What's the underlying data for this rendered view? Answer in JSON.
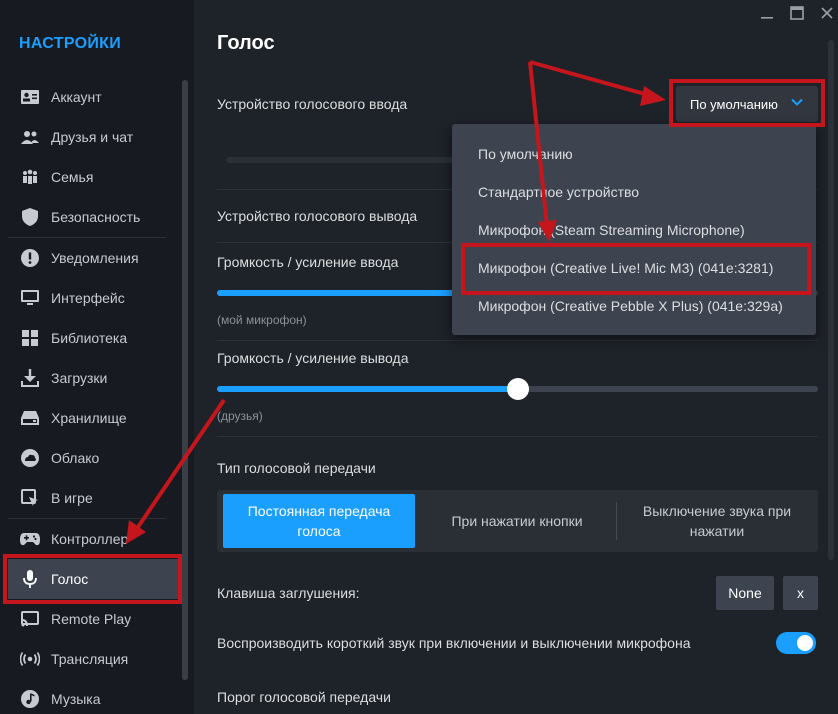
{
  "window": {
    "minimize_icon": "minimize-icon",
    "maximize_icon": "maximize-icon",
    "close_icon": "close-icon"
  },
  "sidebar": {
    "title": "НАСТРОЙКИ",
    "items": [
      {
        "label": "Аккаунт",
        "icon": "id-card-icon"
      },
      {
        "label": "Друзья и чат",
        "icon": "friends-icon"
      },
      {
        "label": "Семья",
        "icon": "family-icon"
      },
      {
        "label": "Безопасность",
        "icon": "shield-icon"
      },
      {
        "label": "Уведомления",
        "icon": "alert-icon"
      },
      {
        "label": "Интерфейс",
        "icon": "monitor-icon"
      },
      {
        "label": "Библиотека",
        "icon": "grid-icon"
      },
      {
        "label": "Загрузки",
        "icon": "download-icon"
      },
      {
        "label": "Хранилище",
        "icon": "drive-icon"
      },
      {
        "label": "Облако",
        "icon": "cloud-icon"
      },
      {
        "label": "В игре",
        "icon": "ingame-icon"
      },
      {
        "label": "Контроллер",
        "icon": "gamepad-icon"
      },
      {
        "label": "Голос",
        "icon": "microphone-icon"
      },
      {
        "label": "Remote Play",
        "icon": "cast-icon"
      },
      {
        "label": "Трансляция",
        "icon": "broadcast-icon"
      },
      {
        "label": "Музыка",
        "icon": "music-icon"
      }
    ]
  },
  "main": {
    "title": "Голос",
    "input_device_label": "Устройство голосового ввода",
    "input_device_value": "По умолчанию",
    "output_device_label": "Устройство голосового вывода",
    "input_volume_label": "Громкость / усиление ввода",
    "input_volume_hint": "(мой микрофон)",
    "output_volume_label": "Громкость / усиление вывода",
    "output_volume_hint": "(друзья)",
    "output_volume_level": 0.5,
    "transmission_label": "Тип голосовой передачи",
    "transmission_options": [
      "Постоянная передача голоса",
      "При нажатии кнопки",
      "Выключение звука при нажатии"
    ],
    "mute_key_label": "Клавиша заглушения:",
    "mute_key_value": "None",
    "mute_key_clear": "x",
    "play_sound_label": "Воспроизводить короткий звук при включении и выключении микрофона",
    "play_sound_enabled": true,
    "threshold_label": "Порог голосовой передачи"
  },
  "menu": {
    "items": [
      "По умолчанию",
      "Стандартное устройство",
      "Микрофон (Steam Streaming Microphone)",
      "Микрофон (Creative Live! Mic M3) (041e:3281)",
      "Микрофон (Creative Pebble X Plus) (041e:329a)"
    ]
  },
  "colors": {
    "accent": "#1a9fff",
    "annotation": "#c4161c",
    "sidebar_bg": "#171a21",
    "content_bg": "#1e2229"
  }
}
